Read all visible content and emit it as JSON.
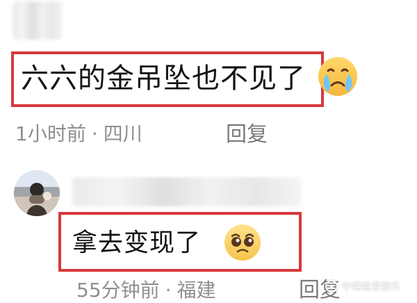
{
  "comments": [
    {
      "text": "六六的金吊坠也不见了",
      "meta": {
        "time": "1小时前",
        "location": "四川"
      },
      "reply_label": "回复",
      "emoji_name": "crying-face"
    },
    {
      "text": "拿去变现了",
      "meta": {
        "time": "55分钟前",
        "location": "福建"
      },
      "reply_label": "回复",
      "emoji_name": "pleading-face"
    }
  ],
  "watermark": {
    "text": "中姐姐爱娱乐"
  },
  "colors": {
    "highlight_border": "#d8383d",
    "meta_text": "#8f8f8f",
    "main_text": "#121212"
  }
}
